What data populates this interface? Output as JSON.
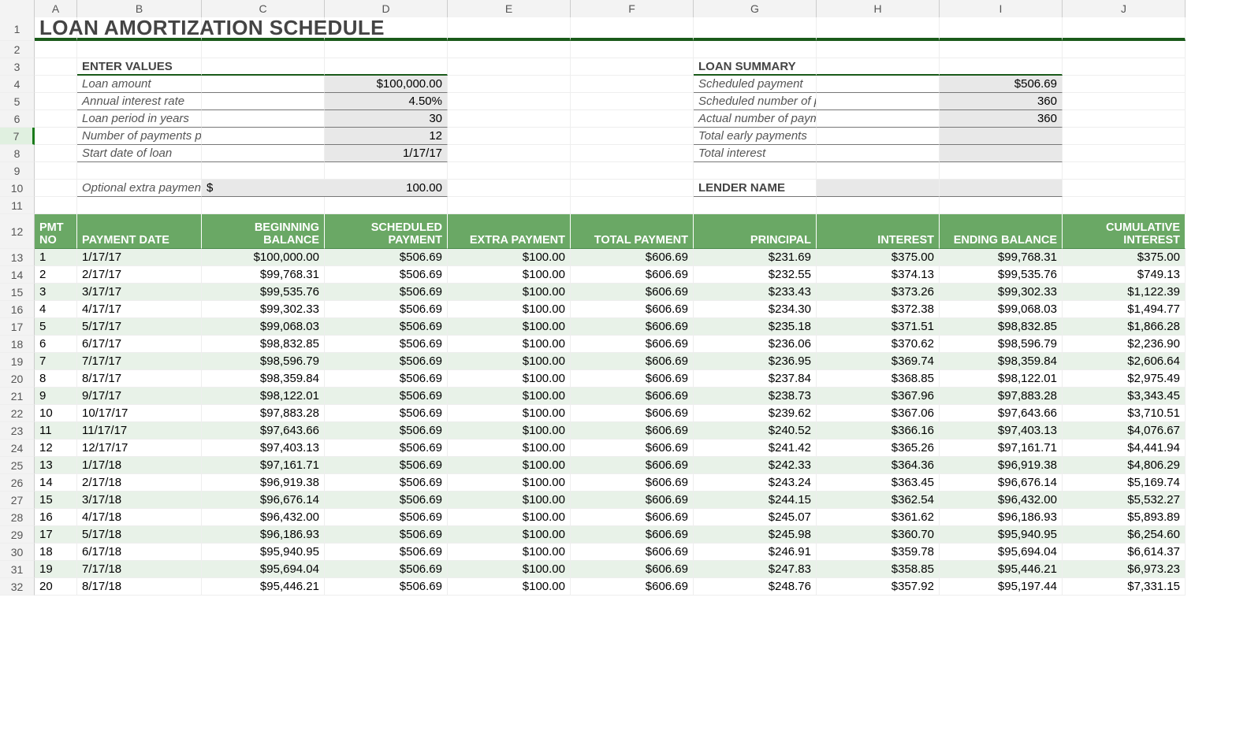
{
  "columns": [
    "A",
    "B",
    "C",
    "D",
    "E",
    "F",
    "G",
    "H",
    "I",
    "J"
  ],
  "rowNumbers": [
    1,
    2,
    3,
    4,
    5,
    6,
    7,
    8,
    9,
    10,
    11,
    12,
    13,
    14,
    15,
    16,
    17,
    18,
    19,
    20,
    21,
    22,
    23,
    24,
    25,
    26,
    27,
    28,
    29,
    30,
    31,
    32
  ],
  "title": "LOAN AMORTIZATION SCHEDULE",
  "sections": {
    "enterValues": "ENTER VALUES",
    "loanSummary": "LOAN SUMMARY",
    "lenderName": "LENDER NAME"
  },
  "inputs": {
    "loanAmountLabel": "Loan amount",
    "loanAmountValue": "$100,000.00",
    "annualRateLabel": "Annual interest rate",
    "annualRateValue": "4.50%",
    "periodYearsLabel": "Loan period in years",
    "periodYearsValue": "30",
    "paymentsPerYearLabel": "Number of payments per year",
    "paymentsPerYearValue": "12",
    "startDateLabel": "Start date of loan",
    "startDateValue": "1/17/17",
    "extraLabel": "Optional extra payments",
    "extraCurrency": "$",
    "extraValue": "100.00"
  },
  "summary": {
    "scheduledPaymentLabel": "Scheduled payment",
    "scheduledPaymentValue": "$506.69",
    "schedNumLabel": "Scheduled number of payments",
    "schedNumValue": "360",
    "actualNumLabel": "Actual number of payments",
    "actualNumValue": "360",
    "earlyLabel": "Total early payments",
    "earlyValue": "",
    "totalInterestLabel": "Total interest",
    "totalInterestValue": ""
  },
  "headers": {
    "pmtNo": "PMT NO",
    "paymentDate": "PAYMENT DATE",
    "begBalance": "BEGINNING BALANCE",
    "schedPayment": "SCHEDULED PAYMENT",
    "extraPayment": "EXTRA PAYMENT",
    "totalPayment": "TOTAL PAYMENT",
    "principal": "PRINCIPAL",
    "interest": "INTEREST",
    "endBalance": "ENDING BALANCE",
    "cumInterest": "CUMULATIVE INTEREST"
  },
  "schedule": [
    {
      "n": "1",
      "date": "1/17/17",
      "beg": "$100,000.00",
      "sched": "$506.69",
      "extra": "$100.00",
      "total": "$606.69",
      "prin": "$231.69",
      "int": "$375.00",
      "end": "$99,768.31",
      "cum": "$375.00"
    },
    {
      "n": "2",
      "date": "2/17/17",
      "beg": "$99,768.31",
      "sched": "$506.69",
      "extra": "$100.00",
      "total": "$606.69",
      "prin": "$232.55",
      "int": "$374.13",
      "end": "$99,535.76",
      "cum": "$749.13"
    },
    {
      "n": "3",
      "date": "3/17/17",
      "beg": "$99,535.76",
      "sched": "$506.69",
      "extra": "$100.00",
      "total": "$606.69",
      "prin": "$233.43",
      "int": "$373.26",
      "end": "$99,302.33",
      "cum": "$1,122.39"
    },
    {
      "n": "4",
      "date": "4/17/17",
      "beg": "$99,302.33",
      "sched": "$506.69",
      "extra": "$100.00",
      "total": "$606.69",
      "prin": "$234.30",
      "int": "$372.38",
      "end": "$99,068.03",
      "cum": "$1,494.77"
    },
    {
      "n": "5",
      "date": "5/17/17",
      "beg": "$99,068.03",
      "sched": "$506.69",
      "extra": "$100.00",
      "total": "$606.69",
      "prin": "$235.18",
      "int": "$371.51",
      "end": "$98,832.85",
      "cum": "$1,866.28"
    },
    {
      "n": "6",
      "date": "6/17/17",
      "beg": "$98,832.85",
      "sched": "$506.69",
      "extra": "$100.00",
      "total": "$606.69",
      "prin": "$236.06",
      "int": "$370.62",
      "end": "$98,596.79",
      "cum": "$2,236.90"
    },
    {
      "n": "7",
      "date": "7/17/17",
      "beg": "$98,596.79",
      "sched": "$506.69",
      "extra": "$100.00",
      "total": "$606.69",
      "prin": "$236.95",
      "int": "$369.74",
      "end": "$98,359.84",
      "cum": "$2,606.64"
    },
    {
      "n": "8",
      "date": "8/17/17",
      "beg": "$98,359.84",
      "sched": "$506.69",
      "extra": "$100.00",
      "total": "$606.69",
      "prin": "$237.84",
      "int": "$368.85",
      "end": "$98,122.01",
      "cum": "$2,975.49"
    },
    {
      "n": "9",
      "date": "9/17/17",
      "beg": "$98,122.01",
      "sched": "$506.69",
      "extra": "$100.00",
      "total": "$606.69",
      "prin": "$238.73",
      "int": "$367.96",
      "end": "$97,883.28",
      "cum": "$3,343.45"
    },
    {
      "n": "10",
      "date": "10/17/17",
      "beg": "$97,883.28",
      "sched": "$506.69",
      "extra": "$100.00",
      "total": "$606.69",
      "prin": "$239.62",
      "int": "$367.06",
      "end": "$97,643.66",
      "cum": "$3,710.51"
    },
    {
      "n": "11",
      "date": "11/17/17",
      "beg": "$97,643.66",
      "sched": "$506.69",
      "extra": "$100.00",
      "total": "$606.69",
      "prin": "$240.52",
      "int": "$366.16",
      "end": "$97,403.13",
      "cum": "$4,076.67"
    },
    {
      "n": "12",
      "date": "12/17/17",
      "beg": "$97,403.13",
      "sched": "$506.69",
      "extra": "$100.00",
      "total": "$606.69",
      "prin": "$241.42",
      "int": "$365.26",
      "end": "$97,161.71",
      "cum": "$4,441.94"
    },
    {
      "n": "13",
      "date": "1/17/18",
      "beg": "$97,161.71",
      "sched": "$506.69",
      "extra": "$100.00",
      "total": "$606.69",
      "prin": "$242.33",
      "int": "$364.36",
      "end": "$96,919.38",
      "cum": "$4,806.29"
    },
    {
      "n": "14",
      "date": "2/17/18",
      "beg": "$96,919.38",
      "sched": "$506.69",
      "extra": "$100.00",
      "total": "$606.69",
      "prin": "$243.24",
      "int": "$363.45",
      "end": "$96,676.14",
      "cum": "$5,169.74"
    },
    {
      "n": "15",
      "date": "3/17/18",
      "beg": "$96,676.14",
      "sched": "$506.69",
      "extra": "$100.00",
      "total": "$606.69",
      "prin": "$244.15",
      "int": "$362.54",
      "end": "$96,432.00",
      "cum": "$5,532.27"
    },
    {
      "n": "16",
      "date": "4/17/18",
      "beg": "$96,432.00",
      "sched": "$506.69",
      "extra": "$100.00",
      "total": "$606.69",
      "prin": "$245.07",
      "int": "$361.62",
      "end": "$96,186.93",
      "cum": "$5,893.89"
    },
    {
      "n": "17",
      "date": "5/17/18",
      "beg": "$96,186.93",
      "sched": "$506.69",
      "extra": "$100.00",
      "total": "$606.69",
      "prin": "$245.98",
      "int": "$360.70",
      "end": "$95,940.95",
      "cum": "$6,254.60"
    },
    {
      "n": "18",
      "date": "6/17/18",
      "beg": "$95,940.95",
      "sched": "$506.69",
      "extra": "$100.00",
      "total": "$606.69",
      "prin": "$246.91",
      "int": "$359.78",
      "end": "$95,694.04",
      "cum": "$6,614.37"
    },
    {
      "n": "19",
      "date": "7/17/18",
      "beg": "$95,694.04",
      "sched": "$506.69",
      "extra": "$100.00",
      "total": "$606.69",
      "prin": "$247.83",
      "int": "$358.85",
      "end": "$95,446.21",
      "cum": "$6,973.23"
    },
    {
      "n": "20",
      "date": "8/17/18",
      "beg": "$95,446.21",
      "sched": "$506.69",
      "extra": "$100.00",
      "total": "$606.69",
      "prin": "$248.76",
      "int": "$357.92",
      "end": "$95,197.44",
      "cum": "$7,331.15"
    }
  ]
}
